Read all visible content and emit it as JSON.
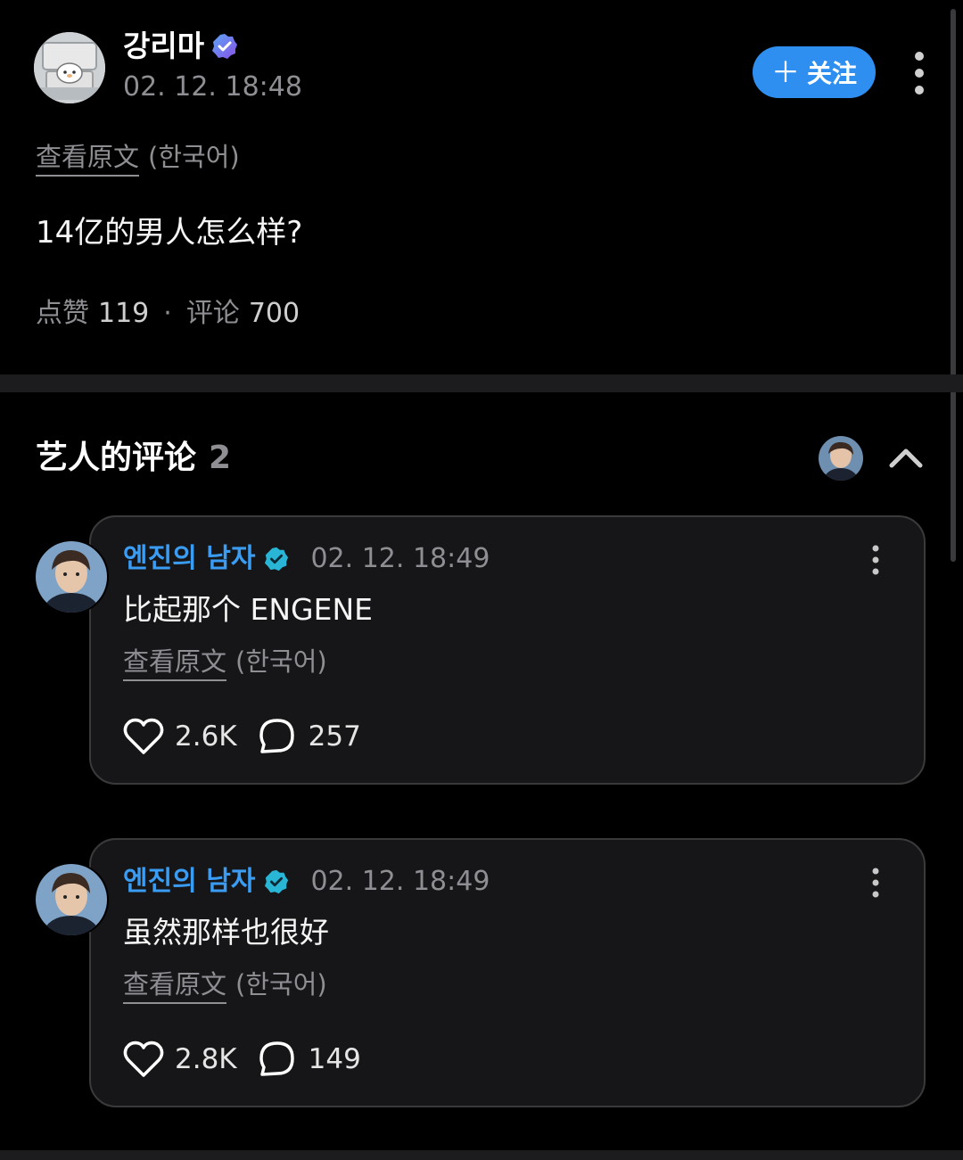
{
  "post": {
    "author_name": "강리마",
    "timestamp": "02. 12. 18:48",
    "follow_label": "关注",
    "translate_link": "查看原文",
    "translate_lang": "(한국어)",
    "body": "14亿的男人怎么样?",
    "likes_label": "点赞",
    "likes_count": "119",
    "separator": "·",
    "comments_label": "评论",
    "comments_count": "700"
  },
  "artist_comments": {
    "title": "艺人的评论",
    "count": "2",
    "items": [
      {
        "author": "엔진의 남자",
        "timestamp": "02. 12. 18:49",
        "text": "比起那个 ENGENE",
        "translate_link": "查看原文",
        "translate_lang": "(한국어)",
        "likes": "2.6K",
        "replies": "257"
      },
      {
        "author": "엔진의 남자",
        "timestamp": "02. 12. 18:49",
        "text": "虽然那样也很好",
        "translate_link": "查看原文",
        "translate_lang": "(한국어)",
        "likes": "2.8K",
        "replies": "149"
      }
    ]
  },
  "colors": {
    "background": "#000000",
    "accent_blue": "#2f8ff0",
    "name_blue": "#3a9cf2",
    "muted": "#8e8e93",
    "card_bg": "#161618",
    "card_border": "#3a3a3c",
    "verified_purple": "#7b5cf0",
    "verified_teal": "#29b6d6"
  },
  "icons": {
    "verified_post": "verified-badge-purple-icon",
    "verified_comment": "verified-badge-teal-icon",
    "like": "heart-icon",
    "reply": "speech-bubble-icon",
    "more": "more-vertical-icon",
    "collapse": "chevron-up-icon",
    "follow": "plus-icon"
  }
}
